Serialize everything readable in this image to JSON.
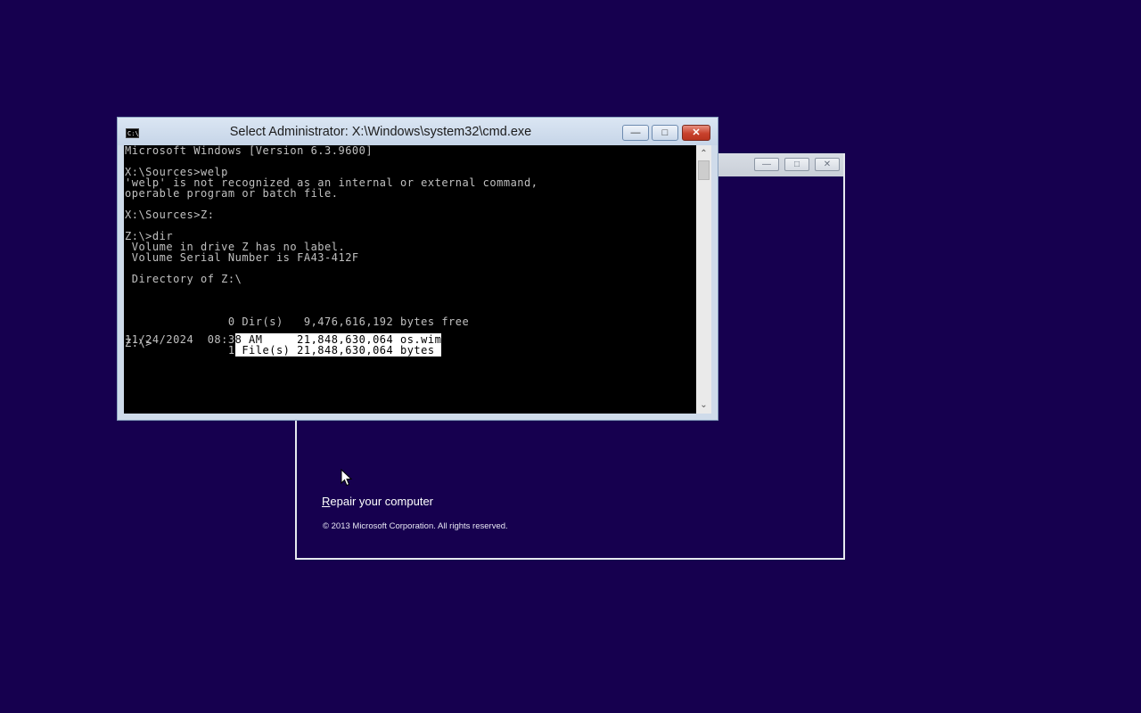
{
  "setup_window": {
    "repair_label_first": "R",
    "repair_label_rest": "epair your computer",
    "copyright": "© 2013 Microsoft Corporation. All rights reserved.",
    "minimize_icon": "minimize-icon",
    "maximize_icon": "maximize-icon",
    "close_icon": "close-icon"
  },
  "cmd_window": {
    "title": "Select Administrator: X:\\Windows\\system32\\cmd.exe",
    "app_icon": "C:\\",
    "console_lines": [
      "Microsoft Windows [Version 6.3.9600]",
      "",
      "X:\\Sources>welp",
      "'welp' is not recognized as an internal or external command,",
      "operable program or batch file.",
      "",
      "X:\\Sources>Z:",
      "",
      "Z:\\>dir",
      " Volume in drive Z has no label.",
      " Volume Serial Number is FA43-412F",
      "",
      " Directory of Z:\\",
      "",
      "",
      "",
      "               0 Dir(s)   9,476,616,192 bytes free",
      "",
      "Z:\\>"
    ],
    "file_line_prefix": "11/24/2024  08:3",
    "file_line_highlight": "8 AM     21,848,630,064 os.wim",
    "files_line_prefix": "               1",
    "files_line_highlight": " File(s) 21,848,630,064 bytes "
  },
  "colors": {
    "desktop_bg": "#16004f",
    "console_bg": "#000000",
    "console_fg": "#c0c0c0",
    "selection_bg": "#ffffff"
  }
}
